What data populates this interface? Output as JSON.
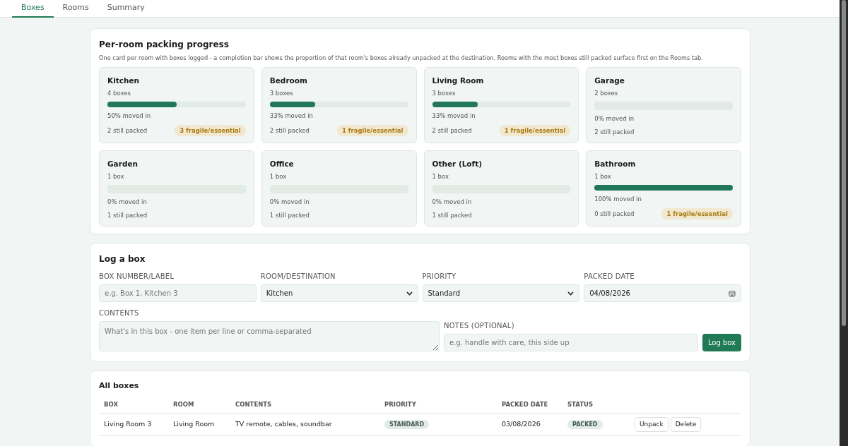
{
  "tabs": [
    {
      "label": "Boxes",
      "selected": true
    },
    {
      "label": "Rooms",
      "selected": false
    },
    {
      "label": "Summary",
      "selected": false
    }
  ],
  "progress": {
    "title": "Per-room packing progress",
    "description": "One card per room with boxes logged - a completion bar shows the proportion of that room's boxes already unpacked at the destination. Rooms with the most boxes still packed surface first on the Rooms tab.",
    "rooms": [
      {
        "name": "Kitchen",
        "count": "4 boxes",
        "level": 0.5,
        "moved": "50% moved in",
        "packed": "2 still packed",
        "badge": "3 fragile/essential"
      },
      {
        "name": "Bedroom",
        "count": "3 boxes",
        "level": 0.33,
        "moved": "33% moved in",
        "packed": "2 still packed",
        "badge": "1 fragile/essential"
      },
      {
        "name": "Living Room",
        "count": "3 boxes",
        "level": 0.33,
        "moved": "33% moved in",
        "packed": "2 still packed",
        "badge": "1 fragile/essential"
      },
      {
        "name": "Garage",
        "count": "2 boxes",
        "level": 0,
        "moved": "0% moved in",
        "packed": "2 still packed"
      },
      {
        "name": "Garden",
        "count": "1 box",
        "level": 0,
        "moved": "0% moved in",
        "packed": "1 still packed"
      },
      {
        "name": "Office",
        "count": "1 box",
        "level": 0,
        "moved": "0% moved in",
        "packed": "1 still packed"
      },
      {
        "name": "Other (Loft)",
        "count": "1 box",
        "level": 0,
        "moved": "0% moved in",
        "packed": "1 still packed"
      },
      {
        "name": "Bathroom",
        "count": "1 box",
        "level": 1,
        "moved": "100% moved in",
        "packed": "0 still packed",
        "badge": "1 fragile/essential"
      }
    ]
  },
  "form": {
    "title": "Log a box",
    "box_label": {
      "label": "BOX NUMBER/LABEL",
      "placeholder": "e.g. Box 1, Kitchen 3"
    },
    "room": {
      "label": "ROOM/DESTINATION",
      "value": "Kitchen"
    },
    "priority": {
      "label": "PRIORITY",
      "value": "Standard"
    },
    "date": {
      "label": "PACKED DATE",
      "value": "04/08/2026"
    },
    "contents": {
      "label": "CONTENTS",
      "placeholder": "What's in this box - one item per line or comma-separated"
    },
    "notes": {
      "label": "NOTES (OPTIONAL)",
      "placeholder": "e.g. handle with care, this side up"
    },
    "submit": "Log box"
  },
  "table": {
    "title": "All boxes",
    "columns": [
      "BOX",
      "ROOM",
      "CONTENTS",
      "PRIORITY",
      "PACKED DATE",
      "STATUS"
    ],
    "rows": [
      {
        "box": "Living Room 3",
        "room": "Living Room",
        "contents": "TV remote, cables, soundbar",
        "priority": {
          "label": "STANDARD",
          "kind": "standard"
        },
        "date": "03/08/2026",
        "status": {
          "label": "PACKED",
          "kind": "packed"
        },
        "actions": [
          "Unpack",
          "Delete"
        ]
      }
    ]
  }
}
